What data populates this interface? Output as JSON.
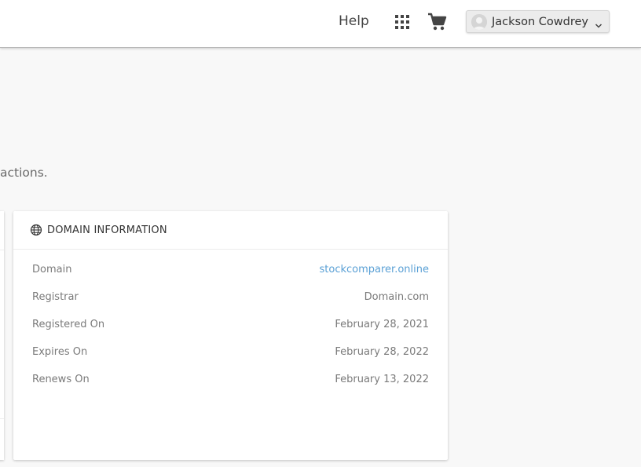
{
  "header": {
    "help_label": "Help",
    "apps_icon": "apps-grid-icon",
    "cart_icon": "shopping-cart-icon",
    "user": {
      "name": "Jackson Cowdrey",
      "avatar_icon": "avatar-placeholder-icon",
      "menu_icon": "chevron-down-icon"
    }
  },
  "main": {
    "intro_text": "actions."
  },
  "domain_card": {
    "title": "DOMAIN INFORMATION",
    "title_icon": "globe-icon",
    "rows": [
      {
        "label": "Domain",
        "value": "stockcomparer.online"
      },
      {
        "label": "Registrar",
        "value": "Domain.com"
      },
      {
        "label": "Registered On",
        "value": "February 28, 2021"
      },
      {
        "label": "Expires On",
        "value": "February 28, 2022"
      },
      {
        "label": "Renews On",
        "value": "February 13, 2022"
      }
    ]
  },
  "colors": {
    "page_background": "#f8f8f8",
    "card_background": "#ffffff",
    "link": "#5aa0d5",
    "label_text": "#7a7a7a"
  }
}
